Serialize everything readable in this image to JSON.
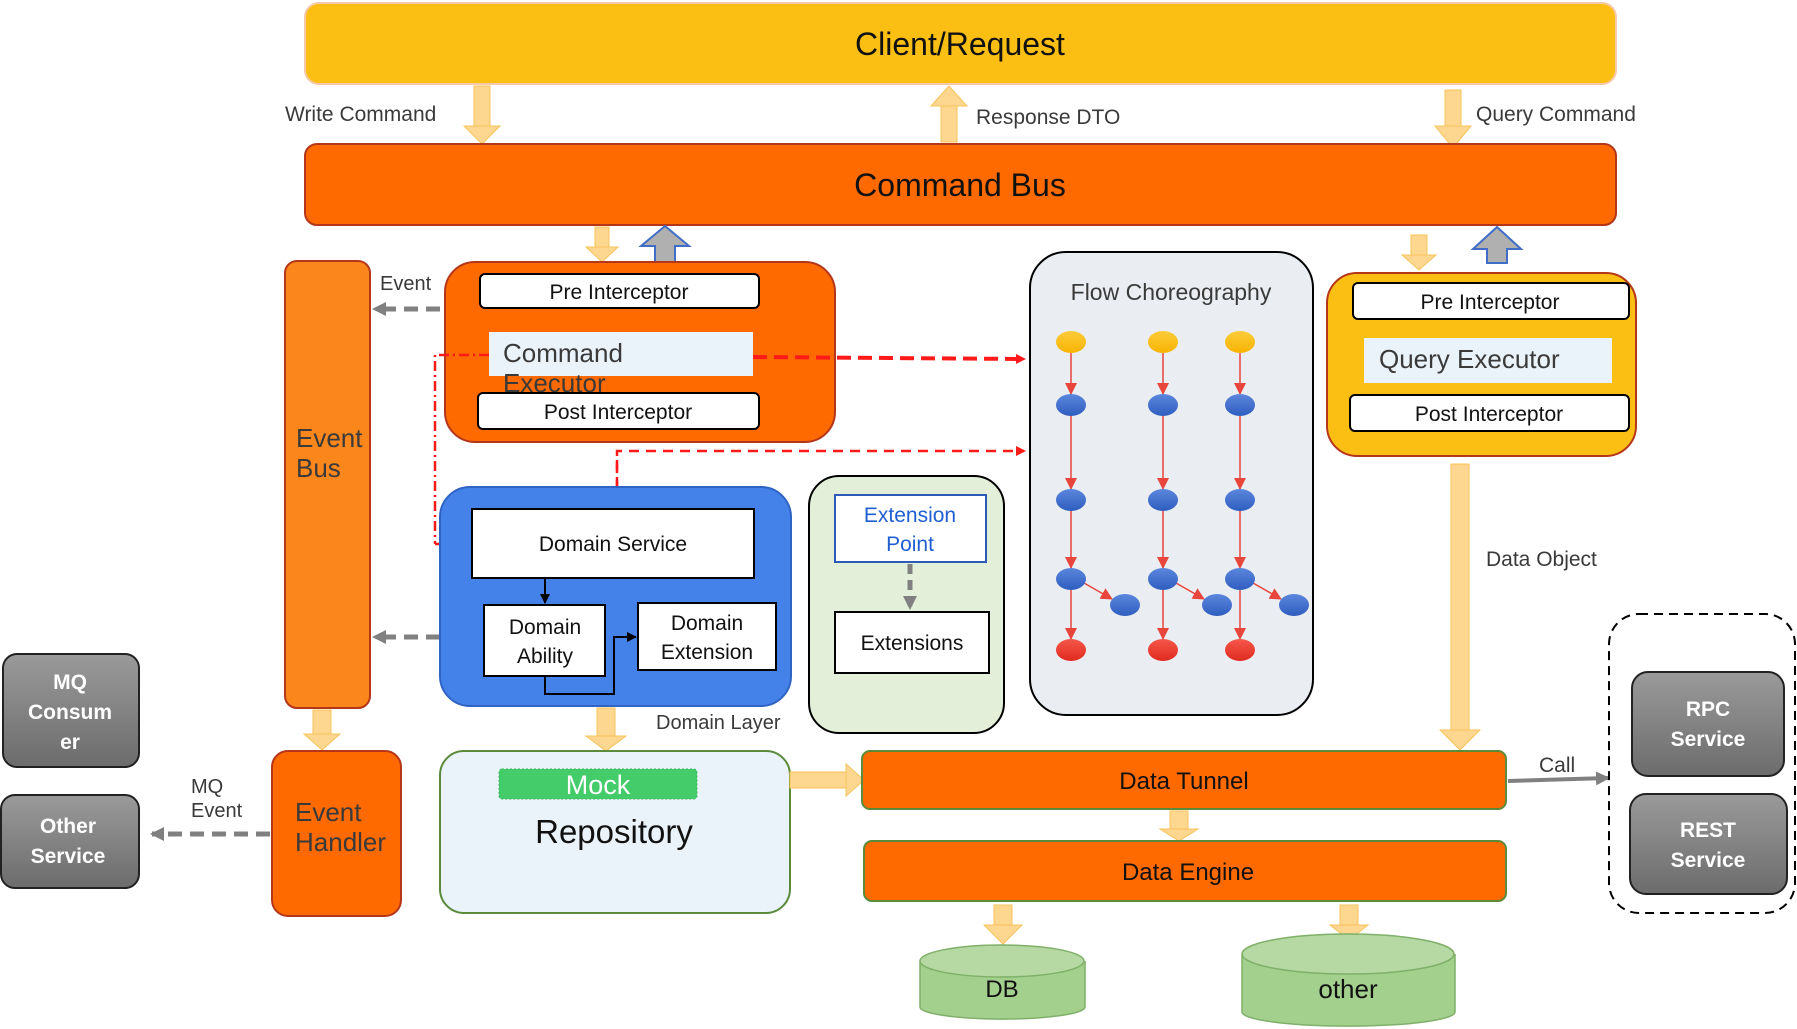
{
  "colors": {
    "client": "#fbbf14",
    "bus_orange": "#ff6a00",
    "event_bus": "#fb861c",
    "domain_blue": "#4482ea",
    "extension_bg": "#e3efd8",
    "flow_bg": "#eaedf1",
    "repo_bg": "#eaf2fa",
    "mock_green": "#45cc6a",
    "db_green": "#a4d08e",
    "service_gray": "#7f7f7f",
    "arrow_yellow": "#fdd690",
    "red_dash": "#ff1a1a",
    "node_yellow": "#fbbf14",
    "node_blue": "#3f6fcd",
    "node_red": "#ee3a2e"
  },
  "top": {
    "client_label": "Client/Request",
    "command_bus_label": "Command Bus",
    "write_command_label": "Write Command",
    "response_dto_label": "Response DTO",
    "query_command_label": "Query Command"
  },
  "command_side": {
    "pre_interceptor": "Pre Interceptor",
    "executor": "Command Executor",
    "post_interceptor": "Post Interceptor",
    "event_label": "Event"
  },
  "event_bus": {
    "label_line1": "Event",
    "label_line2": "Bus"
  },
  "domain": {
    "service": "Domain Service",
    "ability_line1": "Domain",
    "ability_line2": "Ability",
    "extension_line1": "Domain",
    "extension_line2": "Extension",
    "layer_label": "Domain Layer"
  },
  "extension_box": {
    "point_line1": "Extension",
    "point_line2": "Point",
    "extensions": "Extensions"
  },
  "flow": {
    "title": "Flow Choreography",
    "columns": 3,
    "node_rows": [
      "start",
      "step",
      "step",
      "step",
      "end"
    ]
  },
  "query_side": {
    "pre_interceptor": "Pre Interceptor",
    "executor": "Query Executor",
    "post_interceptor": "Post Interceptor",
    "data_object_label": "Data Object"
  },
  "event_handler": {
    "label_line1": "Event",
    "label_line2": "Handler",
    "mq_event_line1": "MQ",
    "mq_event_line2": "Event"
  },
  "external_left": {
    "mq_consumer_line1": "MQ",
    "mq_consumer_line2": "Consum",
    "mq_consumer_line3": "er",
    "other_service_line1": "Other",
    "other_service_line2": "Service"
  },
  "repository": {
    "mock": "Mock",
    "label": "Repository"
  },
  "data": {
    "tunnel": "Data Tunnel",
    "engine": "Data Engine",
    "db": "DB",
    "other": "other",
    "call_label": "Call"
  },
  "external_right": {
    "rpc_line1": "RPC",
    "rpc_line2": "Service",
    "rest_line1": "REST",
    "rest_line2": "Service"
  }
}
